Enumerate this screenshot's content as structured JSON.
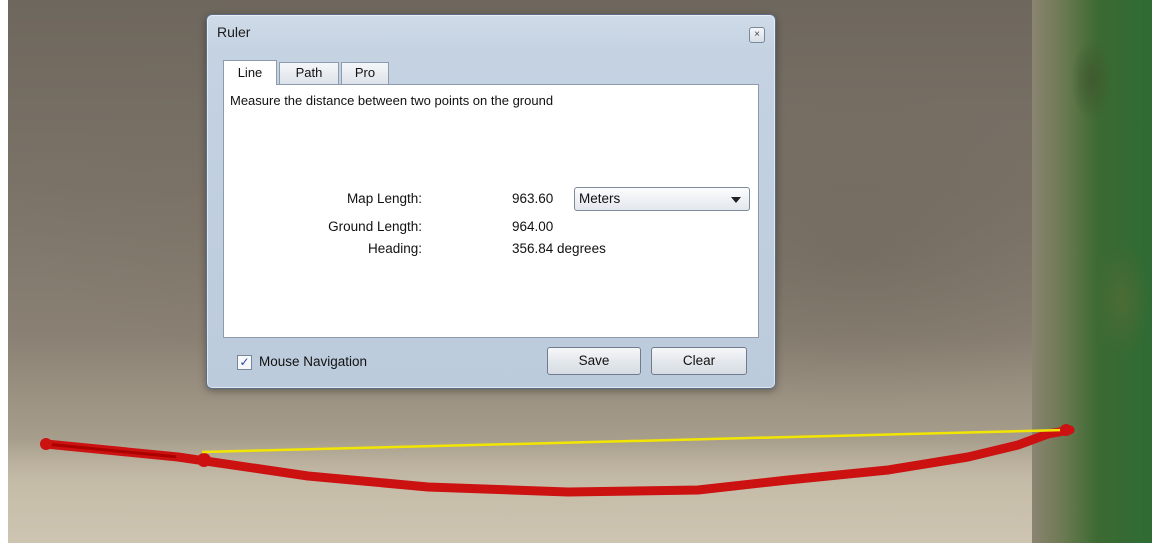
{
  "dialog": {
    "title": "Ruler",
    "close_glyph": "×",
    "tabs": [
      {
        "label": "Line",
        "active": true
      },
      {
        "label": "Path",
        "active": false
      },
      {
        "label": "Pro",
        "active": false
      }
    ],
    "description": "Measure the distance between two points on the ground",
    "measurements": {
      "map_length_label": "Map Length:",
      "map_length_value": "963.60",
      "ground_length_label": "Ground Length:",
      "ground_length_value": "964.00",
      "heading_label": "Heading:",
      "heading_value": "356.84 degrees"
    },
    "units": {
      "selected": "Meters"
    },
    "mouse_navigation": {
      "label": "Mouse Navigation",
      "checked": true,
      "check_glyph": "✓"
    },
    "buttons": {
      "save": "Save",
      "clear": "Clear"
    }
  },
  "colors": {
    "path": "#cc1111",
    "ruler_line": "#f2e600"
  }
}
